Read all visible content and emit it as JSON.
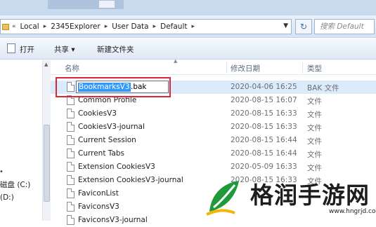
{
  "address": {
    "crumbs": [
      "Local",
      "2345Explorer",
      "User Data",
      "Default"
    ],
    "nav_back_glyph": "«",
    "search_placeholder": "搜索 Default"
  },
  "toolbar": {
    "open_label": "打开",
    "share_label": "共享 ▾",
    "new_folder_label": "新建文件夹"
  },
  "nav": {
    "items": [
      "磁盘 (C:)",
      "(D:)"
    ]
  },
  "columns": {
    "name": "名称",
    "date": "修改日期",
    "type": "类型"
  },
  "rename": {
    "selected_text": "BookmarksV3",
    "rest_text": ".bak"
  },
  "files": [
    {
      "name": "BookmarksV3.bak",
      "date": "2020-04-06 16:25",
      "type": "BAK 文件"
    },
    {
      "name": "Common Profile",
      "date": "2020-08-15 16:07",
      "type": "文件"
    },
    {
      "name": "CookiesV3",
      "date": "2020-08-15 16:33",
      "type": "文件"
    },
    {
      "name": "CookiesV3-journal",
      "date": "2020-08-15 16:33",
      "type": "文件"
    },
    {
      "name": "Current Session",
      "date": "2020-08-15 16:44",
      "type": "文件"
    },
    {
      "name": "Current Tabs",
      "date": "2020-08-15 16:44",
      "type": "文件"
    },
    {
      "name": "Extension CookiesV3",
      "date": "2020-05-09 16:33",
      "type": "文件"
    },
    {
      "name": "Extension CookiesV3-journal",
      "date": "2020-08-15 16:33",
      "type": "文件"
    },
    {
      "name": "FaviconList",
      "date": "",
      "type": ""
    },
    {
      "name": "FaviconsV3",
      "date": "",
      "type": ""
    },
    {
      "name": "FaviconsV3-journal",
      "date": "",
      "type": ""
    }
  ],
  "watermark": {
    "text": "格润手游网",
    "url": "www.hngrjd.com"
  },
  "colors": {
    "selection": "#3399ff",
    "highlight_box": "#d9263a",
    "row_selected": "#dcebfc"
  }
}
